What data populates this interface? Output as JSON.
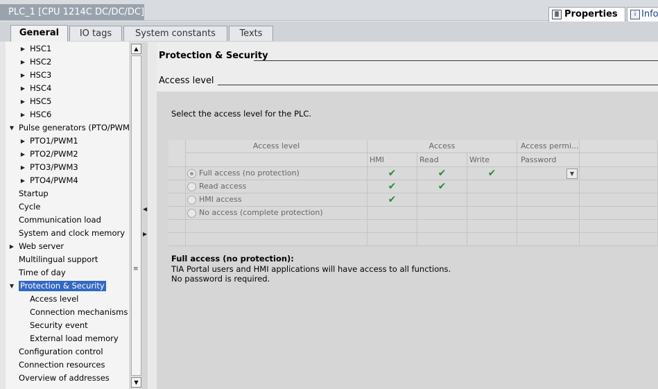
{
  "window": {
    "title": "PLC_1 [CPU 1214C DC/DC/DC]"
  },
  "inspector_tabs": {
    "properties": "Properties",
    "info": "Info"
  },
  "tabs": [
    "General",
    "IO tags",
    "System constants",
    "Texts"
  ],
  "nav": {
    "items": [
      {
        "label": "HSC1",
        "expander": "collapsed"
      },
      {
        "label": "HSC2",
        "expander": "collapsed"
      },
      {
        "label": "HSC3",
        "expander": "collapsed"
      },
      {
        "label": "HSC4",
        "expander": "collapsed"
      },
      {
        "label": "HSC5",
        "expander": "collapsed"
      },
      {
        "label": "HSC6",
        "expander": "collapsed"
      },
      {
        "label": "Pulse generators (PTO/PWM)",
        "expander": "expanded"
      },
      {
        "label": "PTO1/PWM1",
        "expander": "collapsed"
      },
      {
        "label": "PTO2/PWM2",
        "expander": "collapsed"
      },
      {
        "label": "PTO3/PWM3",
        "expander": "collapsed"
      },
      {
        "label": "PTO4/PWM4",
        "expander": "collapsed"
      },
      {
        "label": "Startup",
        "expander": "none"
      },
      {
        "label": "Cycle",
        "expander": "none"
      },
      {
        "label": "Communication load",
        "expander": "none"
      },
      {
        "label": "System and clock memory",
        "expander": "none"
      },
      {
        "label": "Web server",
        "expander": "collapsed"
      },
      {
        "label": "Multilingual support",
        "expander": "none"
      },
      {
        "label": "Time of day",
        "expander": "none"
      },
      {
        "label": "Protection & Security",
        "expander": "expanded",
        "selected": true
      },
      {
        "label": "Access level",
        "expander": "none"
      },
      {
        "label": "Connection mechanisms",
        "expander": "none"
      },
      {
        "label": "Security event",
        "expander": "none"
      },
      {
        "label": "External load memory",
        "expander": "none"
      },
      {
        "label": "Configuration control",
        "expander": "none"
      },
      {
        "label": "Connection resources",
        "expander": "none"
      },
      {
        "label": "Overview of addresses",
        "expander": "none"
      }
    ]
  },
  "content": {
    "section_title": "Protection & Security",
    "subsection_title": "Access level",
    "description": "Select the access level for the PLC.",
    "grid": {
      "headers": {
        "access_level": "Access level",
        "access": "Access",
        "access_permission": "Access permi...",
        "hmi": "HMI",
        "read": "Read",
        "write": "Write",
        "password": "Password"
      },
      "rows": [
        {
          "label": "Full access (no protection)",
          "selected": true,
          "hmi": true,
          "read": true,
          "write": true,
          "password_dropdown": true
        },
        {
          "label": "Read access",
          "selected": false,
          "hmi": true,
          "read": true,
          "write": false,
          "password_dropdown": false
        },
        {
          "label": "HMI access",
          "selected": false,
          "hmi": true,
          "read": false,
          "write": false,
          "password_dropdown": false
        },
        {
          "label": "No access (complete protection)",
          "selected": false,
          "hmi": false,
          "read": false,
          "write": false,
          "password_dropdown": false
        }
      ]
    },
    "info": {
      "title": "Full access (no protection):",
      "line1": "TIA Portal users and HMI applications will have access to all functions.",
      "line2": "No password is required."
    }
  },
  "colors": {
    "selection": "#3268c4",
    "check": "#2e8b3a",
    "title_bar": "#9aa3ad"
  },
  "icons": {
    "collapsed": "triangle-right-icon",
    "expanded": "triangle-down-icon",
    "check": "check-icon",
    "dropdown": "chevron-down-icon"
  }
}
